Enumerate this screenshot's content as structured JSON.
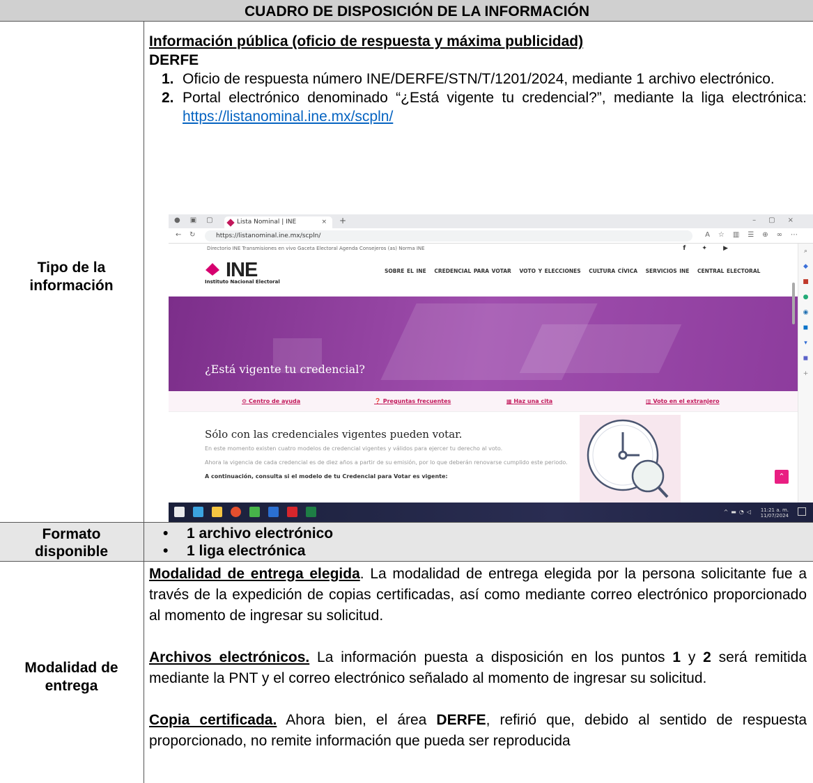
{
  "header": {
    "title": "CUADRO DE DISPOSICIÓN DE LA INFORMACIÓN"
  },
  "tipo": {
    "label": "Tipo de la información",
    "heading": "Información pública (oficio de respuesta y máxima publicidad)",
    "area": "DERFE",
    "items": [
      {
        "num": "1.",
        "text": "Oficio de respuesta número INE/DERFE/STN/T/1201/2024, mediante 1 archivo electrónico."
      },
      {
        "num": "2.",
        "text": "Portal electrónico denominado “¿Está vigente tu credencial?”, mediante la liga electrónica: ",
        "link": "https://listanominal.ine.mx/scpln/"
      }
    ]
  },
  "screenshot": {
    "tab_title": "Lista Nominal | INE",
    "url": "https://listanominal.ine.mx/scpln/",
    "topbar": "Directorio INE   Transmisiones en vivo   Gaceta Electoral   Agenda Consejeros (as)   Norma INE",
    "logo_word": "INE",
    "logo_sub": "Instituto Nacional Electoral",
    "menu": [
      "SOBRE EL INE",
      "CREDENCIAL PARA VOTAR",
      "VOTO Y ELECCIONES",
      "CULTURA CÍVICA",
      "SERVICIOS INE",
      "CENTRAL ELECTORAL"
    ],
    "hero_title": "¿Está vigente tu credencial?",
    "links": [
      "Centro de ayuda",
      "Preguntas frecuentes",
      "Haz una cita",
      "Voto en el extranjero"
    ],
    "body_heading": "Sólo con las credenciales vigentes pueden votar.",
    "body_p1": "En este momento existen cuatro modelos de credencial vigentes y válidos para ejercer tu derecho al voto.",
    "body_p2": "Ahora la vigencia de cada credencial es de diez años a partir de su emisión, por lo que deberán renovarse cumplido este periodo.",
    "body_p3": "A continuación, consulta si el modelo de tu Credencial para Votar es vigente:",
    "clock_time": "11:21 a. m.",
    "clock_date": "11/07/2024"
  },
  "formato": {
    "label": "Formato disponible",
    "items": [
      "1 archivo electrónico",
      "1 liga electrónica"
    ]
  },
  "modalidad": {
    "label": "Modalidad de entrega",
    "p1_lead": "Modalidad de entrega elegida",
    "p1_text": ". La modalidad de entrega elegida por la persona solicitante fue a través de la expedición de copias certificadas, así como mediante correo electrónico proporcionado al momento de ingresar su solicitud.",
    "p2_lead": "Archivos electrónicos.",
    "p2_a": " La información puesta a disposición en los puntos ",
    "p2_b1": "1",
    "p2_c": " y ",
    "p2_b2": "2",
    "p2_d": " será remitida mediante la PNT y el correo electrónico señalado al momento de ingresar su solicitud.",
    "p3_lead": "Copia certificada.",
    "p3_a": " Ahora bien, el área ",
    "p3_b": "DERFE",
    "p3_c": ", refirió que, debido al sentido de respuesta proporcionado, no remite información que pueda ser reproducida"
  }
}
